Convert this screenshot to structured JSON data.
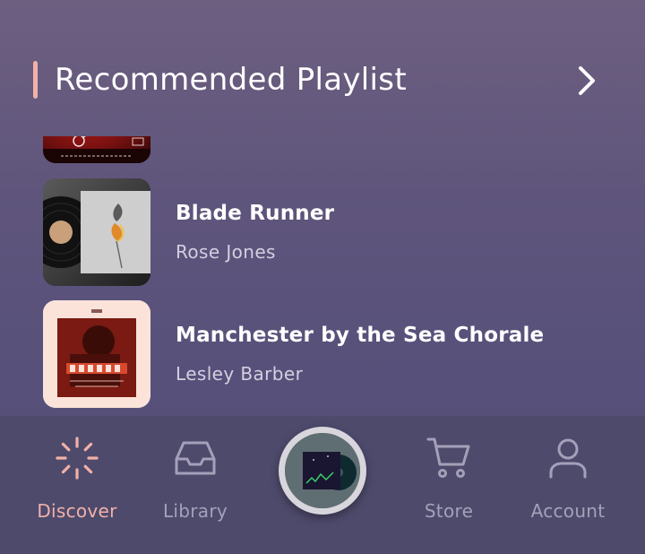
{
  "header": {
    "title": "Recommended Playlist",
    "accent_color": "#f2b1a8"
  },
  "playlist": [
    {
      "title": "",
      "artist": "",
      "cover": "red-album-cover"
    },
    {
      "title": "Blade Runner",
      "artist": "Rose Jones",
      "cover": "vinyl-rose-cover"
    },
    {
      "title": "Manchester by the Sea Chorale",
      "artist": "Lesley Barber",
      "cover": "electro-poster-cover"
    }
  ],
  "nav": {
    "items": [
      {
        "label": "Discover",
        "icon": "loader-icon",
        "active": true
      },
      {
        "label": "Library",
        "icon": "inbox-icon",
        "active": false
      },
      {
        "label": "Store",
        "icon": "cart-icon",
        "active": false
      },
      {
        "label": "Account",
        "icon": "user-icon",
        "active": false
      }
    ],
    "active_color": "#f2b1a8",
    "inactive_color": "#a5a0b9"
  }
}
